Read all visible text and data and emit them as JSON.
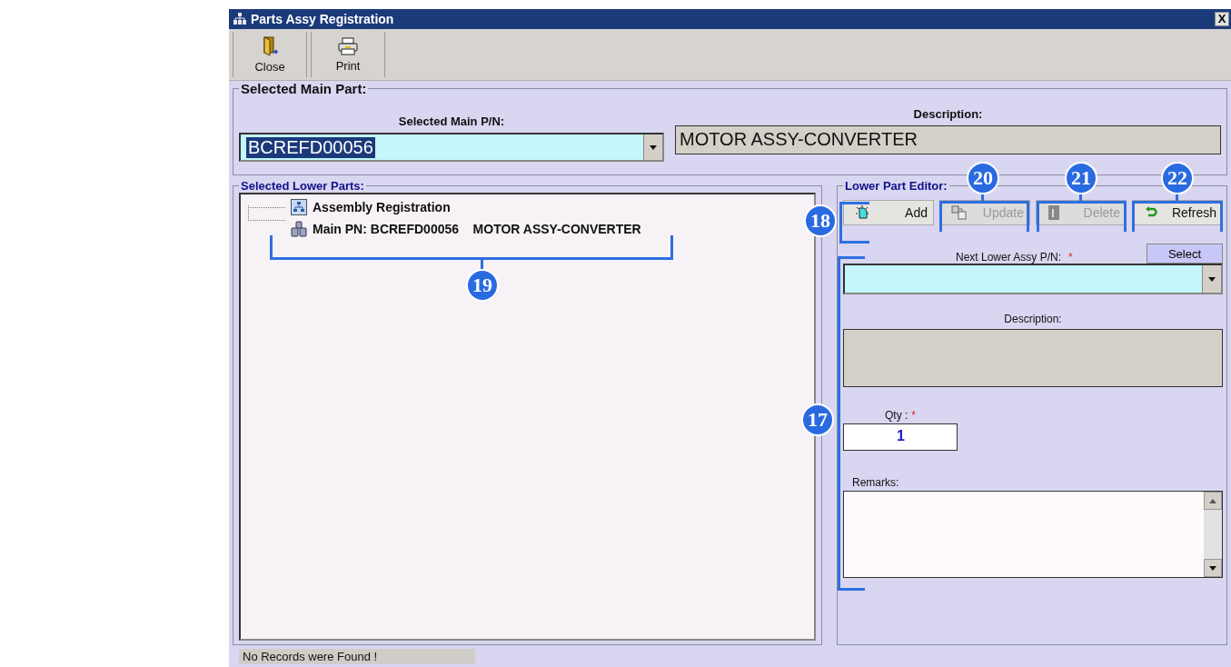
{
  "window": {
    "title": "Parts Assy Registration",
    "close_glyph": "X"
  },
  "toolbar": [
    {
      "label": "Close",
      "kind": "close"
    },
    {
      "label": "Print",
      "kind": "print"
    }
  ],
  "main_part": {
    "title": "Selected Main Part:",
    "pn_label": "Selected Main P/N:",
    "pn_value": "BCREFD00056",
    "description_label": "Description:",
    "description_value": "MOTOR ASSY-CONVERTER"
  },
  "lower_parts": {
    "title": "Selected Lower Parts:",
    "tree": [
      {
        "label": "Assembly Registration",
        "kind": "root"
      },
      {
        "label": "Main PN: BCREFD00056    MOTOR ASSY-CONVERTER",
        "kind": "part"
      }
    ]
  },
  "editor": {
    "title": "Lower Part Editor:",
    "buttons": [
      {
        "label": "Add",
        "kind": "add",
        "disabled": false
      },
      {
        "label": "Update",
        "kind": "update",
        "disabled": true
      },
      {
        "label": "Delete",
        "kind": "delete",
        "disabled": true
      },
      {
        "label": "Refresh",
        "kind": "refresh",
        "disabled": false
      }
    ],
    "next_pn_label": "Next Lower Assy P/N:",
    "required_mark": "*",
    "select_button": "Select",
    "description_label": "Description:",
    "qty_label": "Qty :",
    "qty_value": "1",
    "remarks_label": "Remarks:"
  },
  "status_bar": "No Records were Found !",
  "callouts": [
    {
      "number": "17"
    },
    {
      "number": "18"
    },
    {
      "number": "19"
    },
    {
      "number": "20"
    },
    {
      "number": "21"
    },
    {
      "number": "22"
    }
  ]
}
